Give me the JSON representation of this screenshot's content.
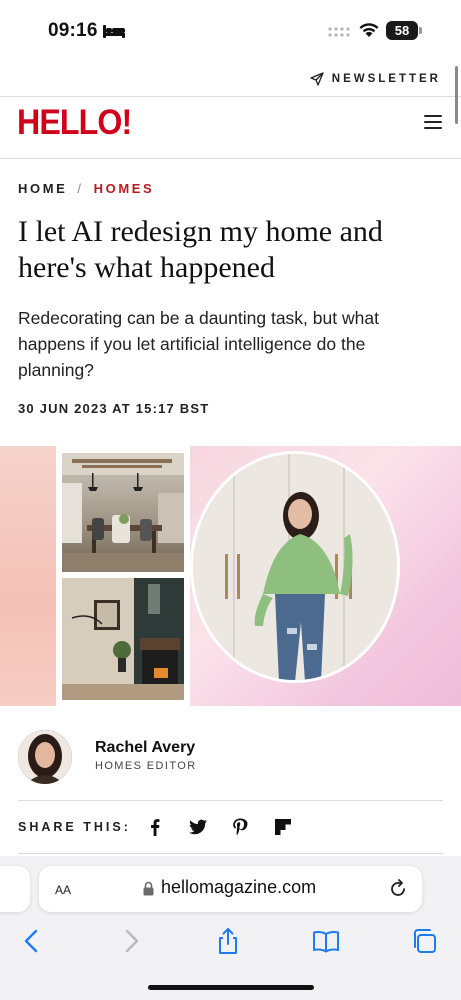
{
  "status_bar": {
    "time": "09:16",
    "battery": "58",
    "icons": [
      "bed-icon",
      "cellular-signal-icon",
      "wifi-icon",
      "battery-icon"
    ]
  },
  "site": {
    "newsletter_label": "NEWSLETTER",
    "logo": "HELLO!",
    "brand_color": "#d0021b"
  },
  "breadcrumb": {
    "home": "HOME",
    "separator": "/",
    "section": "HOMES",
    "section_color": "#b41e1e"
  },
  "article": {
    "headline": "I let AI redesign my home and here's what happened",
    "standfirst": "Redecorating can be a daunting task, but what happens if you let artificial intelligence do the planning?",
    "date": "30 JUN 2023 AT 15:17 BST"
  },
  "author": {
    "name": "Rachel Avery",
    "role": "HOMES EDITOR"
  },
  "share": {
    "label": "SHARE THIS:",
    "icons": [
      "facebook-icon",
      "twitter-icon",
      "pinterest-icon",
      "flipboard-icon"
    ]
  },
  "browser": {
    "aa_label": "AA",
    "url": "hellomagazine.com",
    "toolbar_icons": [
      "back-arrow-icon",
      "forward-arrow-icon",
      "share-icon",
      "bookmarks-icon",
      "tabs-icon"
    ]
  }
}
